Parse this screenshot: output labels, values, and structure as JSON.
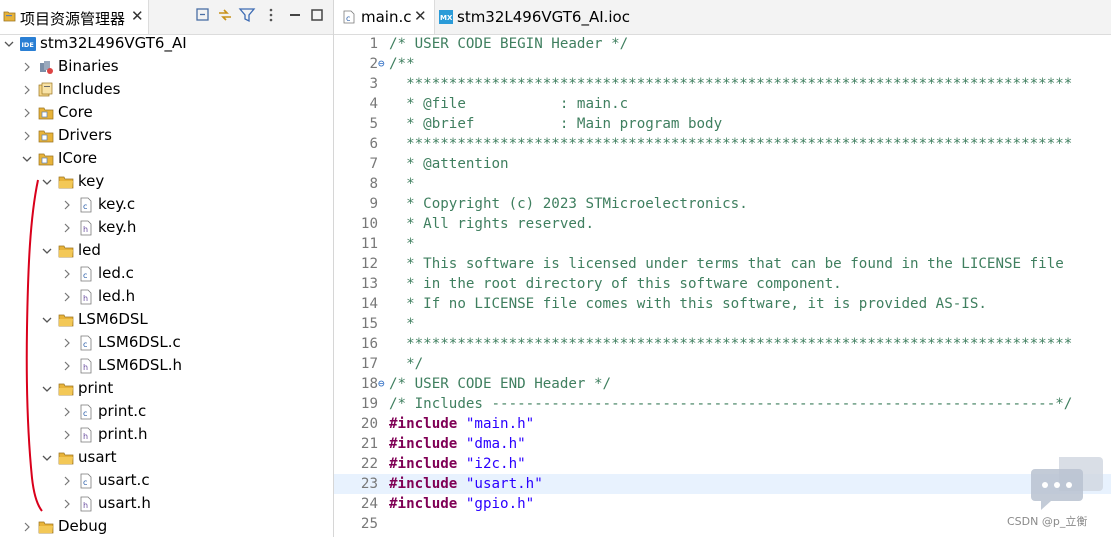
{
  "explorer": {
    "tab_label": "项目资源管理器",
    "tab_close": "✕",
    "toolbar_icons": [
      "collapse-all-icon",
      "link-editor-icon",
      "filter-icon",
      "view-menu-icon",
      "minimize-icon",
      "maximize-icon"
    ],
    "tree": [
      {
        "label": "stm32L496VGT6_AI",
        "depth": 0,
        "expanded": true,
        "icon": "project-icon"
      },
      {
        "label": "Binaries",
        "depth": 1,
        "expanded": false,
        "icon": "binaries-icon"
      },
      {
        "label": "Includes",
        "depth": 1,
        "expanded": false,
        "icon": "includes-icon"
      },
      {
        "label": "Core",
        "depth": 1,
        "expanded": false,
        "icon": "source-folder-icon"
      },
      {
        "label": "Drivers",
        "depth": 1,
        "expanded": false,
        "icon": "source-folder-icon"
      },
      {
        "label": "ICore",
        "depth": 1,
        "expanded": true,
        "icon": "source-folder-icon"
      },
      {
        "label": "key",
        "depth": 2,
        "expanded": true,
        "icon": "folder-icon"
      },
      {
        "label": "key.c",
        "depth": 3,
        "expanded": false,
        "icon": "c-file-icon"
      },
      {
        "label": "key.h",
        "depth": 3,
        "expanded": false,
        "icon": "h-file-icon"
      },
      {
        "label": "led",
        "depth": 2,
        "expanded": true,
        "icon": "folder-icon"
      },
      {
        "label": "led.c",
        "depth": 3,
        "expanded": false,
        "icon": "c-file-icon"
      },
      {
        "label": "led.h",
        "depth": 3,
        "expanded": false,
        "icon": "h-file-icon"
      },
      {
        "label": "LSM6DSL",
        "depth": 2,
        "expanded": true,
        "icon": "folder-icon"
      },
      {
        "label": "LSM6DSL.c",
        "depth": 3,
        "expanded": false,
        "icon": "c-file-icon"
      },
      {
        "label": "LSM6DSL.h",
        "depth": 3,
        "expanded": false,
        "icon": "h-file-icon"
      },
      {
        "label": "print",
        "depth": 2,
        "expanded": true,
        "icon": "folder-icon"
      },
      {
        "label": "print.c",
        "depth": 3,
        "expanded": false,
        "icon": "c-file-icon"
      },
      {
        "label": "print.h",
        "depth": 3,
        "expanded": false,
        "icon": "h-file-icon"
      },
      {
        "label": "usart",
        "depth": 2,
        "expanded": true,
        "icon": "folder-icon"
      },
      {
        "label": "usart.c",
        "depth": 3,
        "expanded": false,
        "icon": "c-file-icon"
      },
      {
        "label": "usart.h",
        "depth": 3,
        "expanded": false,
        "icon": "h-file-icon"
      },
      {
        "label": "Debug",
        "depth": 1,
        "expanded": false,
        "icon": "folder-icon"
      }
    ]
  },
  "editor": {
    "tabs": [
      {
        "label": "main.c",
        "icon": "c-file-icon",
        "active": true,
        "close": "✕"
      },
      {
        "label": "stm32L496VGT6_AI.ioc",
        "icon": "mx-file-icon",
        "active": false
      }
    ],
    "current_line": 23,
    "lines": [
      {
        "n": "1",
        "fold": "",
        "segs": [
          {
            "t": "/* USER CODE BEGIN Header */",
            "c": "cmt"
          }
        ]
      },
      {
        "n": "2",
        "fold": "⊖",
        "segs": [
          {
            "t": "/**",
            "c": "cmt"
          }
        ]
      },
      {
        "n": "3",
        "fold": "",
        "segs": [
          {
            "t": "  ******************************************************************************",
            "c": "cmt"
          }
        ]
      },
      {
        "n": "4",
        "fold": "",
        "segs": [
          {
            "t": "  * @file           : main.c",
            "c": "cmt"
          }
        ]
      },
      {
        "n": "5",
        "fold": "",
        "segs": [
          {
            "t": "  * @brief          : Main program body",
            "c": "cmt"
          }
        ]
      },
      {
        "n": "6",
        "fold": "",
        "segs": [
          {
            "t": "  ******************************************************************************",
            "c": "cmt"
          }
        ]
      },
      {
        "n": "7",
        "fold": "",
        "segs": [
          {
            "t": "  * @attention",
            "c": "cmt"
          }
        ]
      },
      {
        "n": "8",
        "fold": "",
        "segs": [
          {
            "t": "  *",
            "c": "cmt"
          }
        ]
      },
      {
        "n": "9",
        "fold": "",
        "segs": [
          {
            "t": "  * Copyright (c) 2023 STMicroelectronics.",
            "c": "cmt"
          }
        ]
      },
      {
        "n": "10",
        "fold": "",
        "segs": [
          {
            "t": "  * All rights reserved.",
            "c": "cmt"
          }
        ]
      },
      {
        "n": "11",
        "fold": "",
        "segs": [
          {
            "t": "  *",
            "c": "cmt"
          }
        ]
      },
      {
        "n": "12",
        "fold": "",
        "segs": [
          {
            "t": "  * This software is licensed under terms that can be found in the LICENSE file",
            "c": "cmt"
          }
        ]
      },
      {
        "n": "13",
        "fold": "",
        "segs": [
          {
            "t": "  * in the root directory of this software component.",
            "c": "cmt"
          }
        ]
      },
      {
        "n": "14",
        "fold": "",
        "segs": [
          {
            "t": "  * If no LICENSE file comes with this software, it is provided AS-IS.",
            "c": "cmt"
          }
        ]
      },
      {
        "n": "15",
        "fold": "",
        "segs": [
          {
            "t": "  *",
            "c": "cmt"
          }
        ]
      },
      {
        "n": "16",
        "fold": "",
        "segs": [
          {
            "t": "  ******************************************************************************",
            "c": "cmt"
          }
        ]
      },
      {
        "n": "17",
        "fold": "",
        "segs": [
          {
            "t": "  */",
            "c": "cmt"
          }
        ]
      },
      {
        "n": "18",
        "fold": "⊖",
        "segs": [
          {
            "t": "/* USER CODE END Header */",
            "c": "cmt"
          }
        ]
      },
      {
        "n": "19",
        "fold": "",
        "segs": [
          {
            "t": "/* Includes ------------------------------------------------------------------*/",
            "c": "cmt"
          }
        ]
      },
      {
        "n": "20",
        "fold": "",
        "segs": [
          {
            "t": "#include",
            "c": "kw"
          },
          {
            "t": " ",
            "c": ""
          },
          {
            "t": "\"main.h\"",
            "c": "str"
          }
        ]
      },
      {
        "n": "21",
        "fold": "",
        "segs": [
          {
            "t": "#include",
            "c": "kw"
          },
          {
            "t": " ",
            "c": ""
          },
          {
            "t": "\"dma.h\"",
            "c": "str"
          }
        ]
      },
      {
        "n": "22",
        "fold": "",
        "segs": [
          {
            "t": "#include",
            "c": "kw"
          },
          {
            "t": " ",
            "c": ""
          },
          {
            "t": "\"i2c.h\"",
            "c": "str"
          }
        ]
      },
      {
        "n": "23",
        "fold": "",
        "segs": [
          {
            "t": "#include",
            "c": "kw"
          },
          {
            "t": " ",
            "c": ""
          },
          {
            "t": "\"usart.h\"",
            "c": "str"
          }
        ]
      },
      {
        "n": "24",
        "fold": "",
        "segs": [
          {
            "t": "#include",
            "c": "kw"
          },
          {
            "t": " ",
            "c": ""
          },
          {
            "t": "\"gpio.h\"",
            "c": "str"
          }
        ]
      },
      {
        "n": "25",
        "fold": "",
        "segs": []
      }
    ]
  },
  "watermark": "CSDN @p_立衡",
  "colors": {
    "keyword": "#7f0055",
    "string": "#2a00ff",
    "comment": "#3f7f5f",
    "annotation": "#d9001b",
    "folder": "#e8b339"
  }
}
